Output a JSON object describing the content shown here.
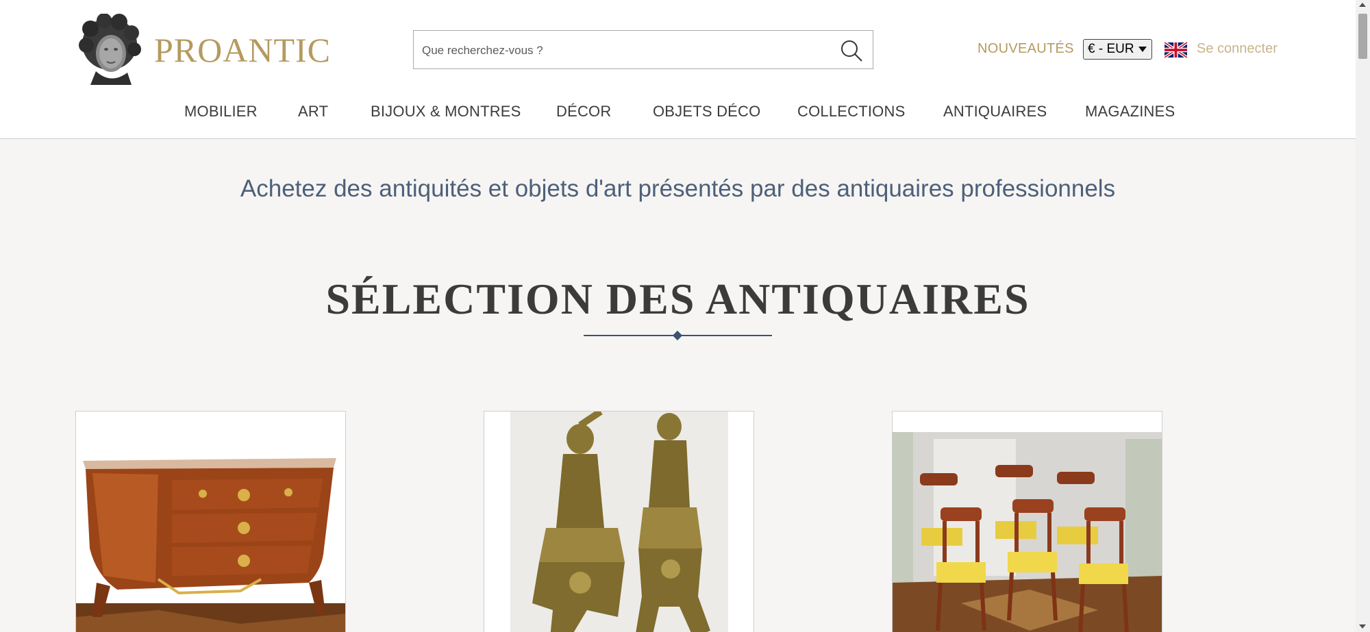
{
  "brand": {
    "name": "PROANTIC",
    "color": "#b59a5f"
  },
  "search": {
    "placeholder": "Que recherchez-vous ?"
  },
  "header": {
    "new_label": "NOUVEAUTÉS",
    "currency_selected": "€ - EUR",
    "language_icon": "uk-flag-icon",
    "login_label": "Se connecter"
  },
  "nav": {
    "items": [
      {
        "label": "MOBILIER"
      },
      {
        "label": "ART"
      },
      {
        "label": "BIJOUX & MONTRES"
      },
      {
        "label": "DÉCOR"
      },
      {
        "label": "OBJETS DÉCO"
      },
      {
        "label": "COLLECTIONS"
      },
      {
        "label": "ANTIQUAIRES"
      },
      {
        "label": "MAGAZINES"
      }
    ]
  },
  "main": {
    "tagline": "Achetez des antiquités et objets d'art présentés par des antiquaires professionnels",
    "section_title": "SÉLECTION DES ANTIQUAIRES",
    "products": [
      {
        "image": "commode-image"
      },
      {
        "image": "bronze-chenets-image"
      },
      {
        "image": "chairs-image"
      }
    ]
  },
  "colors": {
    "accent": "#b59a5f",
    "tagline": "#4d607a",
    "rule": "#3d5170",
    "background": "#f6f5f3"
  }
}
